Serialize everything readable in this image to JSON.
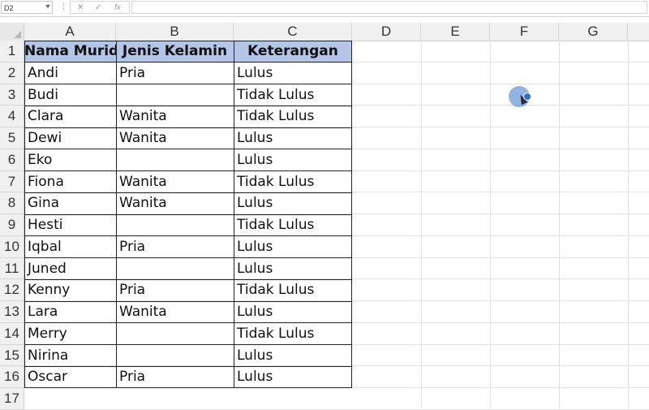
{
  "formula_bar": {
    "name_box": "D2",
    "dots": "⋮",
    "cancel_icon": "✕",
    "enter_icon": "✓",
    "function_icon": "fx",
    "formula_value": ""
  },
  "columns": [
    "A",
    "B",
    "C",
    "D",
    "E",
    "F",
    "G"
  ],
  "rows": [
    "1",
    "2",
    "3",
    "4",
    "5",
    "6",
    "7",
    "8",
    "9",
    "10",
    "11",
    "12",
    "13",
    "14",
    "15",
    "16",
    "17"
  ],
  "table": {
    "headers": [
      "Nama Murid",
      "Jenis Kelamin",
      "Keterangan"
    ],
    "rows": [
      [
        "Andi",
        "Pria",
        "Lulus"
      ],
      [
        "Budi",
        "",
        "Tidak Lulus"
      ],
      [
        "Clara",
        "Wanita",
        "Tidak Lulus"
      ],
      [
        "Dewi",
        "Wanita",
        "Lulus"
      ],
      [
        "Eko",
        "",
        "Lulus"
      ],
      [
        "Fiona",
        "Wanita",
        "Tidak Lulus"
      ],
      [
        "Gina",
        "Wanita",
        "Lulus"
      ],
      [
        "Hesti",
        "",
        "Tidak Lulus"
      ],
      [
        "Iqbal",
        "Pria",
        "Lulus"
      ],
      [
        "Juned",
        "",
        "Lulus"
      ],
      [
        "Kenny",
        "Pria",
        "Tidak Lulus"
      ],
      [
        "Lara",
        "Wanita",
        "Lulus"
      ],
      [
        "Merry",
        "",
        "Tidak Lulus"
      ],
      [
        "Nirina",
        "",
        "Lulus"
      ],
      [
        "Oscar",
        "Pria",
        "Lulus"
      ]
    ]
  },
  "colors": {
    "header_fill": "#b4c6e7",
    "cursor_highlight": "#4882d2"
  },
  "icons": {
    "cursor": "mouse-pointer-icon"
  }
}
